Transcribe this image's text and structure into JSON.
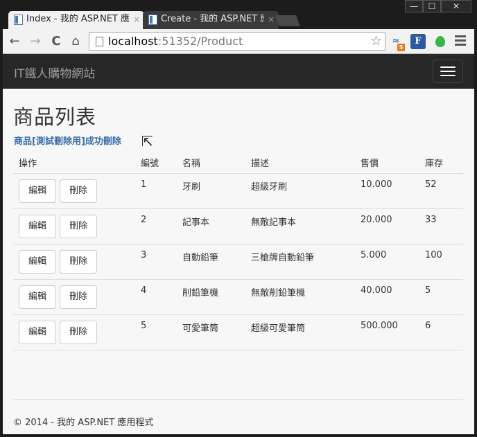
{
  "window": {
    "min": "—",
    "max": "☐",
    "close": "✕"
  },
  "tabs": [
    {
      "title": "Index - 我的 ASP.NET 應用程式",
      "close": "×",
      "active": true
    },
    {
      "title": "Create - 我的 ASP.NET 應用程式",
      "close": "×",
      "active": false
    }
  ],
  "toolbar": {
    "back": "←",
    "forward": "→",
    "reload": "C",
    "home": "⌂",
    "url_host": "localhost",
    "url_path": ":51352/Product",
    "star": "☆",
    "ext_badge": "5",
    "ext_f": "F"
  },
  "navbar": {
    "brand": "IT鐵人購物網站"
  },
  "page": {
    "title": "商品列表",
    "message": "商品[測試刪除用]成功刪除",
    "columns": {
      "op": "操作",
      "id": "編號",
      "name": "名稱",
      "desc": "描述",
      "price": "售價",
      "stock": "庫存"
    },
    "edit_label": "編輯",
    "delete_label": "刪除",
    "rows": [
      {
        "id": "1",
        "name": "牙刷",
        "desc": "超級牙刷",
        "price": "10.000",
        "stock": "52"
      },
      {
        "id": "2",
        "name": "記事本",
        "desc": "無敵記事本",
        "price": "20.000",
        "stock": "33"
      },
      {
        "id": "3",
        "name": "自動鉛筆",
        "desc": "三槍牌自動鉛筆",
        "price": "5.000",
        "stock": "100"
      },
      {
        "id": "4",
        "name": "削鉛筆機",
        "desc": "無敵削鉛筆機",
        "price": "40.000",
        "stock": "5"
      },
      {
        "id": "5",
        "name": "可愛筆筒",
        "desc": "超級可愛筆筒",
        "price": "500.000",
        "stock": "6"
      }
    ],
    "footer": "© 2014 - 我的 ASP.NET 應用程式"
  }
}
